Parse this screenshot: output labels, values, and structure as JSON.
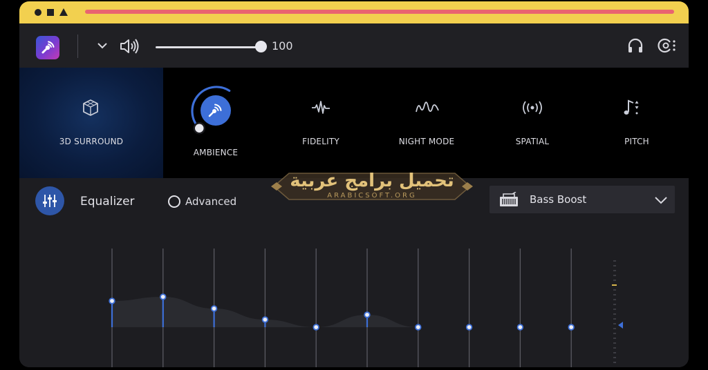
{
  "app": {
    "logo_icon": "sound-waves-icon"
  },
  "topbar": {
    "volume_value": "100",
    "volume_level": 1.0
  },
  "effects": {
    "items": [
      {
        "label": "3D SURROUND",
        "icon": "cube-icon",
        "selected": true
      },
      {
        "label": "AMBIENCE",
        "icon": "ambience-waves-icon",
        "level": 0.62
      },
      {
        "label": "FIDELITY",
        "icon": "waveform-icon"
      },
      {
        "label": "NIGHT MODE",
        "icon": "wave-icon"
      },
      {
        "label": "SPATIAL",
        "icon": "radiating-speaker-icon"
      },
      {
        "label": "PITCH",
        "icon": "music-note-icon"
      }
    ]
  },
  "equalizer": {
    "title": "Equalizer",
    "advanced_label": "Advanced",
    "advanced_checked": false,
    "preset": {
      "label": "Bass Boost",
      "icon": "boombox-icon"
    },
    "band_levels": [
      0.38,
      0.44,
      0.27,
      0.11,
      0.0,
      0.18,
      0.0,
      0.0,
      0.0,
      0.0
    ]
  },
  "watermark": {
    "text": "تحميل برامج عربية",
    "sub": "ARABICSOFT.ORG"
  },
  "colors": {
    "accent": "#3d6fd8",
    "titlebar": "#f2d04f",
    "titlebar_bar": "#e96470",
    "surround_bg": "#0b1d3f"
  }
}
